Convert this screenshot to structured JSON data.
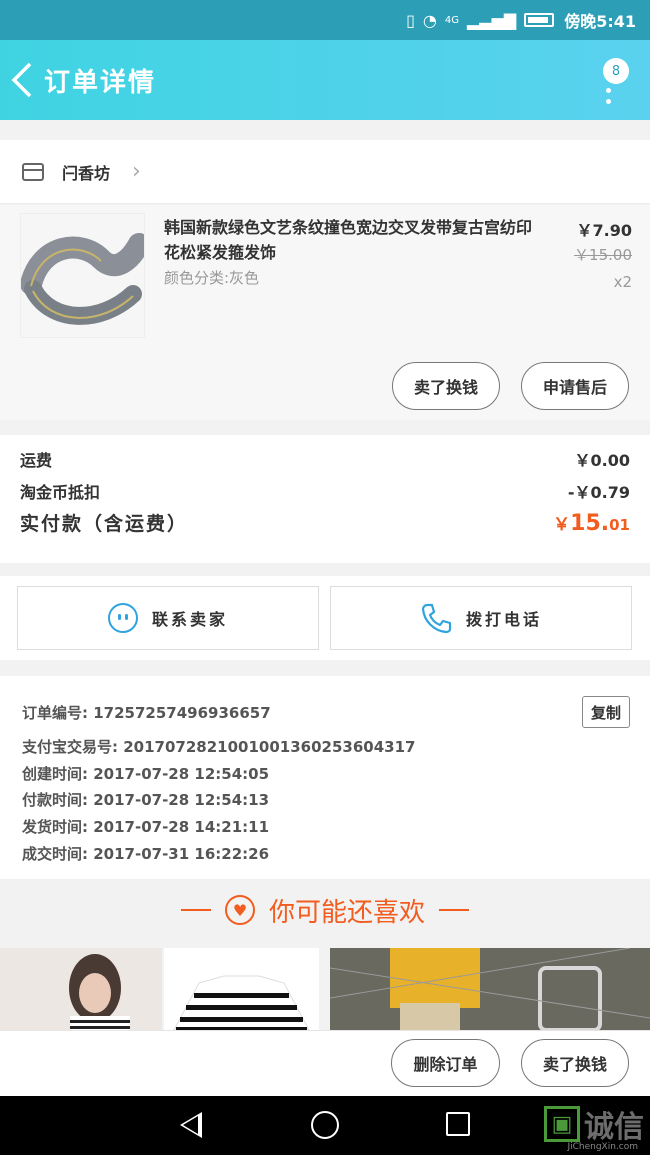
{
  "status_bar": {
    "time": "傍晚5:41",
    "network": "4G"
  },
  "header": {
    "title": "订单详情",
    "badge_count": "8"
  },
  "shop": {
    "name": "闩香坊"
  },
  "product": {
    "name": "韩国新款绿色文艺条纹撞色宽边交叉发带复古宫纺印花松紧发箍发饰",
    "spec": "颜色分类:灰色",
    "price": "￥7.90",
    "original_price": "￥15.00",
    "quantity": "x2",
    "btn_resell": "卖了换钱",
    "btn_aftersale": "申请售后"
  },
  "fees": {
    "shipping_label": "运费",
    "shipping_value": "￥0.00",
    "coin_label": "淘金币抵扣",
    "coin_value": "-￥0.79",
    "total_label": "实付款（含运费）",
    "total_currency": "￥",
    "total_int": "15.",
    "total_dec": "01"
  },
  "actions": {
    "contact_seller": "联系卖家",
    "call_phone": "拨打电话"
  },
  "order_info": {
    "order_no_label": "订单编号: ",
    "order_no": "17257257496936657",
    "copy_label": "复制",
    "alipay_label": "支付宝交易号: ",
    "alipay_no": "2017072821001001360253604317",
    "created_label": "创建时间: ",
    "created": "2017-07-28 12:54:05",
    "paid_label": "付款时间: ",
    "paid": "2017-07-28 12:54:13",
    "shipped_label": "发货时间: ",
    "shipped": "2017-07-28 14:21:11",
    "completed_label": "成交时间: ",
    "completed": "2017-07-31 16:22:26"
  },
  "recommend": {
    "title": "你可能还喜欢"
  },
  "bottom_bar": {
    "delete_order": "删除订单",
    "resell": "卖了换钱"
  },
  "watermark": {
    "text": "诚信",
    "url": "JiChengXin.com"
  },
  "colors": {
    "accent": "#3fd3e2",
    "price_orange": "#f25c1f",
    "link_blue": "#2ea3dd"
  }
}
